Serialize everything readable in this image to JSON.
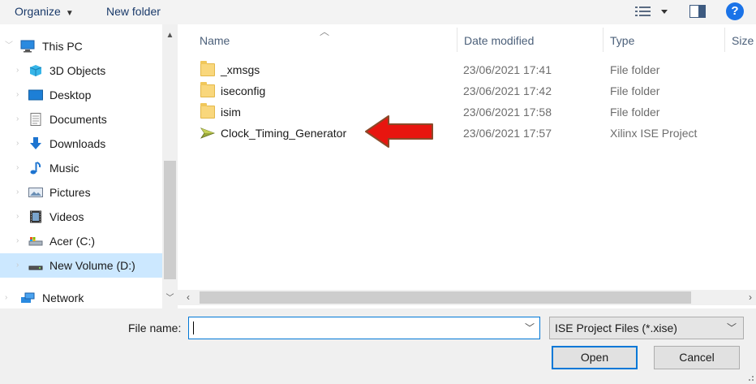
{
  "toolbar": {
    "organize_label": "Organize",
    "new_folder_label": "New folder",
    "help_label": "?",
    "view_icon": "view-options-icon",
    "pane_icon": "preview-pane-icon"
  },
  "nav": {
    "items": [
      {
        "label": "This PC",
        "icon": "this-pc-icon"
      },
      {
        "label": "3D Objects",
        "icon": "3d-objects-icon"
      },
      {
        "label": "Desktop",
        "icon": "desktop-icon"
      },
      {
        "label": "Documents",
        "icon": "documents-icon"
      },
      {
        "label": "Downloads",
        "icon": "downloads-icon"
      },
      {
        "label": "Music",
        "icon": "music-icon"
      },
      {
        "label": "Pictures",
        "icon": "pictures-icon"
      },
      {
        "label": "Videos",
        "icon": "videos-icon"
      },
      {
        "label": "Acer (C:)",
        "icon": "drive-c-icon"
      },
      {
        "label": "New Volume (D:)",
        "icon": "drive-d-icon",
        "selected": true
      },
      {
        "label": "Network",
        "icon": "network-icon"
      }
    ]
  },
  "list": {
    "columns": [
      "Name",
      "Date modified",
      "Type",
      "Size"
    ],
    "rows": [
      {
        "name": "_xmsgs",
        "date": "23/06/2021 17:41",
        "type": "File folder",
        "icon": "folder-icon"
      },
      {
        "name": "iseconfig",
        "date": "23/06/2021 17:42",
        "type": "File folder",
        "icon": "folder-icon"
      },
      {
        "name": "isim",
        "date": "23/06/2021 17:58",
        "type": "File folder",
        "icon": "folder-icon"
      },
      {
        "name": "Clock_Timing_Generator",
        "date": "23/06/2021 17:57",
        "type": "Xilinx ISE Project",
        "icon": "ise-project-icon"
      }
    ]
  },
  "bottom": {
    "file_name_label": "File name:",
    "file_name_value": "",
    "file_type_selected": "ISE Project Files (*.xise)",
    "open_label": "Open",
    "cancel_label": "Cancel"
  },
  "colors": {
    "selected_nav": "#cce8ff",
    "accent": "#0078d7",
    "annotation_arrow": "#e8150f"
  }
}
